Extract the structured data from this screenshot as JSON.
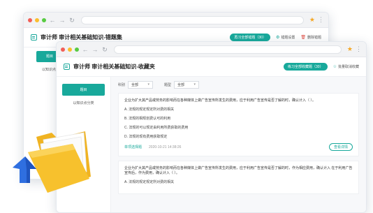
{
  "back_window": {
    "title": "审计师 审计相关基础知识-错题集",
    "pill": "再习全部错题（30）",
    "link1": "错题设置",
    "link2": "删除错题",
    "side_active": "题目",
    "side_item": "以知识点"
  },
  "front_window": {
    "title": "审计师 审计相关基础知识-收藏夹",
    "pill": "练习全部收藏题（30）",
    "link": "批量取消收藏",
    "side_active": "题目",
    "side_item": "以知识点分类",
    "filter1_label": "科别",
    "filter1_value": "全部",
    "filter2_label": "题型",
    "filter2_value": "全部",
    "cards": [
      {
        "question": "企业为扩大其产品或劳务的影响而在各种媒体上做广告宣传所发生的费用，应于利用广告宣传是否了解的时，确认计入（ ）。",
        "options": [
          "A. 法规的规定规定所对费的相关",
          "B. 法规的相规划费认可的利用",
          "C. 法规的可以规定由利用所费获取的费用",
          "D. 法规的现有费用获取规定"
        ],
        "tag": "单项选择题",
        "time": "2020-10-21 14:38:26",
        "detail": "查看详情"
      },
      {
        "question": "企业为扩大其产品或劳务的影响而在各种媒体上做广告宣传所发生的费用，应于利用广告宣传是否了解的时，作为相应费用，确认计入 在于利用广告宣传后，作为费用，确认计入（ ）。",
        "options": [
          "A. 法规的规定规定所对费的相关"
        ],
        "tag": "",
        "time": "",
        "detail": ""
      }
    ]
  },
  "colors": {
    "accent": "#18a99b",
    "folder": "#f7c12d",
    "arrow": "#2f6fe0"
  }
}
